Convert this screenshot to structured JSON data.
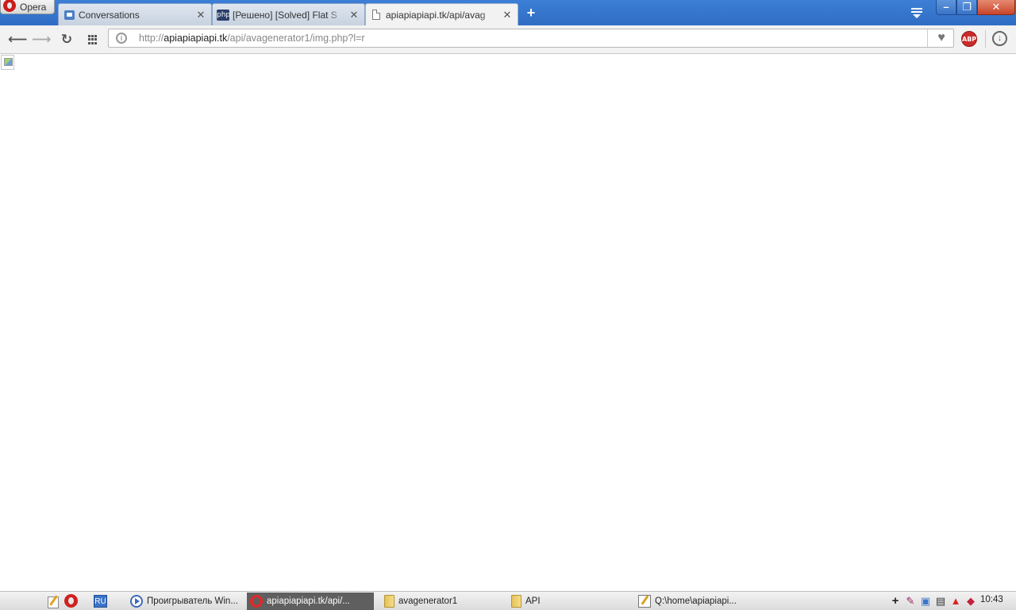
{
  "browser": {
    "menu_label": "Opera",
    "tabs": [
      {
        "title": "Conversations",
        "icon": "conversations-icon",
        "active": false
      },
      {
        "title": "[Решено] [Solved] Flat S",
        "icon": "php-icon",
        "active": false
      },
      {
        "title": "apiapiapiapi.tk/api/avag",
        "icon": "document-icon",
        "active": true
      }
    ],
    "new_tab_glyph": "+",
    "url": {
      "scheme": "http://",
      "host": "apiapiapiapi.tk",
      "path": "/api/avagenerator1/img.php?l=r"
    },
    "extension_label": "ABP"
  },
  "taskbar": {
    "language": "RU",
    "tasks": [
      {
        "label": "Проигрыватель Win...",
        "icon": "media-player-icon",
        "active": false
      },
      {
        "label": "apiapiapiapi.tk/api/...",
        "icon": "opera-icon",
        "active": true
      },
      {
        "label": "avagenerator1",
        "icon": "folder-icon",
        "active": false
      },
      {
        "label": "API",
        "icon": "folder-icon",
        "active": false
      },
      {
        "label": "Q:\\home\\apiapiapi...",
        "icon": "notepad-icon",
        "active": false
      }
    ],
    "clock": "10:43"
  },
  "colors": {
    "titlebar": "#2f6dc4",
    "active_task": "#5f5f5f",
    "abp": "#cc2b2b"
  }
}
